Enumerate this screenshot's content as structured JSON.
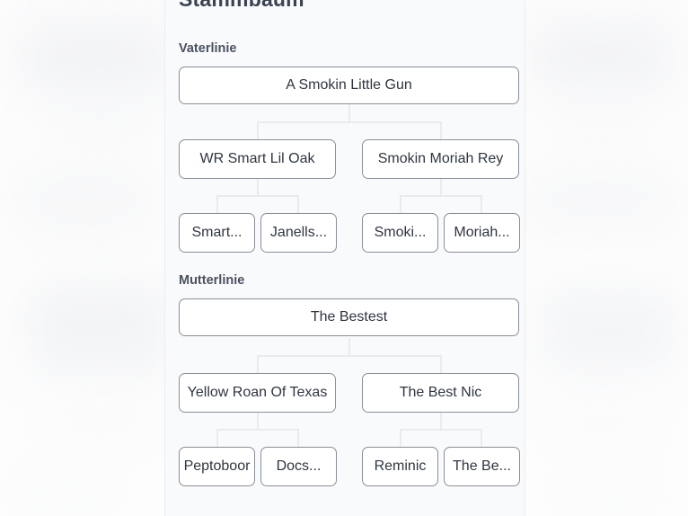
{
  "modal": {
    "title": "Stammbaum",
    "sire_section_label": "Vaterlinie",
    "dam_section_label": "Mutterlinie"
  },
  "pedigree": {
    "sire_line": {
      "generation_1": [
        "A Smokin Little Gun"
      ],
      "generation_2": [
        "WR Smart Lil Oak",
        "Smokin Moriah Rey"
      ],
      "generation_3": [
        "Smart...",
        "Janells...",
        "Smoki...",
        "Moriah..."
      ]
    },
    "dam_line": {
      "generation_1": [
        "The Bestest"
      ],
      "generation_2": [
        "Yellow Roan Of Texas",
        "The Best Nic"
      ],
      "generation_3": [
        "Peptoboor",
        "Docs...",
        "Reminic",
        "The Be..."
      ]
    }
  },
  "colors": {
    "panel_background": "#f9fafb",
    "node_background": "#ffffff",
    "node_border": "#8a8f98",
    "node_text": "#2f3640",
    "heading_text": "#3b4351",
    "label_text": "#4a5161",
    "connector": "#e9ebee",
    "backdrop": "#fafafb"
  }
}
